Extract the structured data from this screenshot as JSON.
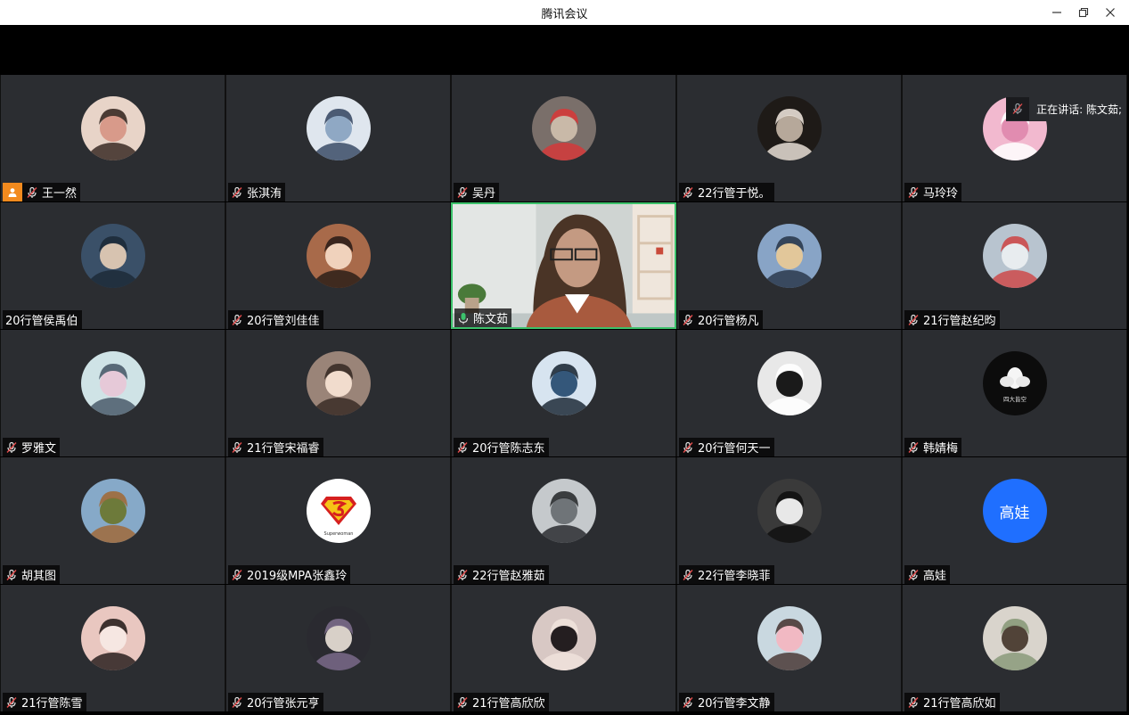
{
  "window": {
    "title": "腾讯会议",
    "controls": [
      "minimize-icon",
      "restore-icon",
      "close-icon"
    ]
  },
  "speaking_banner": {
    "text": "正在讲话: 陈文茹;"
  },
  "colors": {
    "tile_bg": "#2b2d31",
    "active_border": "#3cc26b",
    "host_badge": "#f28a1e",
    "text_avatar_bg": "#1f6fff"
  },
  "participants": [
    {
      "name": "王一然",
      "muted": true,
      "host": true,
      "avatar": "photo"
    },
    {
      "name": "张淇洧",
      "muted": true,
      "avatar": "photo"
    },
    {
      "name": "吴丹",
      "muted": true,
      "avatar": "photo"
    },
    {
      "name": "22行管于悦。",
      "muted": true,
      "avatar": "photo"
    },
    {
      "name": "马玲玲",
      "muted": true,
      "avatar": "photo"
    },
    {
      "name": "20行管侯禹伯",
      "muted": false,
      "mic_hidden": true,
      "avatar": "photo"
    },
    {
      "name": "20行管刘佳佳",
      "muted": true,
      "avatar": "photo"
    },
    {
      "name": "陈文茹",
      "muted": false,
      "speaking": true,
      "video": true
    },
    {
      "name": "20行管杨凡",
      "muted": true,
      "avatar": "photo"
    },
    {
      "name": "21行管赵纪昀",
      "muted": true,
      "avatar": "photo"
    },
    {
      "name": "罗雅文",
      "muted": true,
      "avatar": "photo"
    },
    {
      "name": "21行管宋福睿",
      "muted": true,
      "avatar": "photo"
    },
    {
      "name": "20行管陈志东",
      "muted": true,
      "avatar": "photo"
    },
    {
      "name": "20行管何天一",
      "muted": true,
      "avatar": "photo"
    },
    {
      "name": "韩婧梅",
      "muted": true,
      "avatar": "photo",
      "avatar_caption": "四大皆空"
    },
    {
      "name": "胡其图",
      "muted": true,
      "avatar": "photo"
    },
    {
      "name": "2019级MPA张鑫玲",
      "muted": true,
      "avatar": "photo",
      "avatar_caption": "Superwoman"
    },
    {
      "name": "22行管赵雅茹",
      "muted": true,
      "avatar": "photo"
    },
    {
      "name": "22行管李晓菲",
      "muted": true,
      "avatar": "photo"
    },
    {
      "name": "高娃",
      "muted": true,
      "avatar": "text",
      "avatar_text": "高娃"
    },
    {
      "name": "21行管陈雪",
      "muted": true,
      "avatar": "photo"
    },
    {
      "name": "20行管张元亨",
      "muted": true,
      "avatar": "photo"
    },
    {
      "name": "21行管高欣欣",
      "muted": true,
      "avatar": "photo"
    },
    {
      "name": "20行管李文静",
      "muted": true,
      "avatar": "photo"
    },
    {
      "name": "21行管高欣如",
      "muted": true,
      "avatar": "photo"
    }
  ]
}
